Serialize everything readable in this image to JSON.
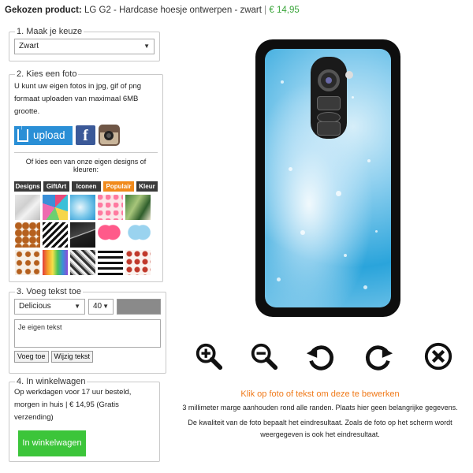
{
  "header": {
    "label": "Gekozen product:",
    "product": "LG G2 - Hardcase hoesje ontwerpen - zwart",
    "separator": "|",
    "price": "€ 14,95"
  },
  "step1": {
    "legend": "1. Maak je keuze",
    "selected": "Zwart"
  },
  "step2": {
    "legend": "2. Kies een foto",
    "intro": "U kunt uw eigen fotos in jpg, gif of png formaat uploaden van maximaal 6MB grootte.",
    "upload_label": "upload",
    "facebook_label": "f",
    "or_text": "Of kies een van onze eigen designs of kleuren:",
    "tabs": [
      "Designs",
      "GiftArt",
      "Iconen",
      "Populair",
      "Kleur"
    ],
    "active_tab": "Populair"
  },
  "step3": {
    "legend": "3. Voeg tekst toe",
    "font": "Delicious",
    "size": "40",
    "text_value": "Je eigen tekst",
    "add_button": "Voeg toe",
    "edit_button": "Wijzig tekst",
    "color": "#8a8a8a"
  },
  "step4": {
    "legend": "4. In winkelwagen",
    "info": "Op werkdagen voor 17 uur besteld, morgen in huis | € 14,95 (Gratis verzending)",
    "cart_button": "In winkelwagen"
  },
  "tools": [
    "zoom-in-icon",
    "zoom-out-icon",
    "rotate-left-icon",
    "rotate-right-icon",
    "delete-icon"
  ],
  "instructions": {
    "heading": "Klik op foto of tekst om deze te bewerken",
    "line1": "3 millimeter marge aanhouden rond alle randen. Plaats hier geen belangrijke gegevens.",
    "line2": "De kwaliteit van de foto bepaalt het eindresultaat. Zoals de foto op het scherm wordt weergegeven is ook het eindresultaat."
  },
  "colors": {
    "accent_orange": "#f08a1c",
    "price_green": "#3aa53a",
    "cart_green": "#3cc53a",
    "upload_blue": "#2a8fd6"
  }
}
